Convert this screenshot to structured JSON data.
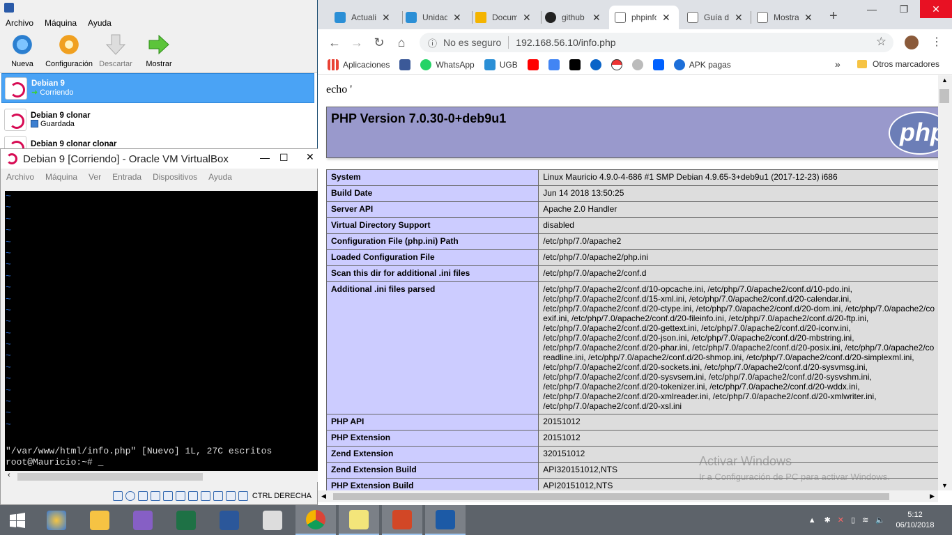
{
  "vbox_manager": {
    "menu": [
      "Archivo",
      "Máquina",
      "Ayuda"
    ],
    "toolbar": [
      "Nueva",
      "Configuración",
      "Descartar",
      "Mostrar"
    ],
    "vms": [
      {
        "name": "Debian 9",
        "state": "Corriendo"
      },
      {
        "name": "Debian 9 clonar",
        "state": "Guardada"
      },
      {
        "name": "Debian 9 clonar clonar",
        "state": ""
      }
    ]
  },
  "vm_window": {
    "title": "Debian 9 [Corriendo] - Oracle VM VirtualBox",
    "menu": [
      "Archivo",
      "Máquina",
      "Ver",
      "Entrada",
      "Dispositivos",
      "Ayuda"
    ],
    "terminal_line1": "\"/var/www/html/info.php\" [Nuevo] 1L, 27C escritos",
    "terminal_line2": "root@Mauricio:~# _",
    "host_key": "CTRL DERECHA"
  },
  "chrome": {
    "tabs": [
      "Actualiz",
      "Unidad",
      "Docum",
      "github",
      "phpinfo",
      "Guía d",
      "Mostra"
    ],
    "active_tab": 4,
    "security": "No es seguro",
    "url": "192.168.56.10/info.php",
    "bookmarks": [
      "Aplicaciones",
      "",
      "WhatsApp",
      "UGB",
      "",
      "",
      "",
      "",
      "",
      "",
      "",
      "APK pagas"
    ],
    "other_bookmarks": "Otros marcadores",
    "page": {
      "echo": "echo '",
      "version": "PHP Version 7.0.30-0+deb9u1",
      "logo": "php",
      "rows": [
        [
          "System",
          "Linux Mauricio 4.9.0-4-686 #1 SMP Debian 4.9.65-3+deb9u1 (2017-12-23) i686"
        ],
        [
          "Build Date",
          "Jun 14 2018 13:50:25"
        ],
        [
          "Server API",
          "Apache 2.0 Handler"
        ],
        [
          "Virtual Directory Support",
          "disabled"
        ],
        [
          "Configuration File (php.ini) Path",
          "/etc/php/7.0/apache2"
        ],
        [
          "Loaded Configuration File",
          "/etc/php/7.0/apache2/php.ini"
        ],
        [
          "Scan this dir for additional .ini files",
          "/etc/php/7.0/apache2/conf.d"
        ],
        [
          "Additional .ini files parsed",
          "/etc/php/7.0/apache2/conf.d/10-opcache.ini, /etc/php/7.0/apache2/conf.d/10-pdo.ini,\n/etc/php/7.0/apache2/conf.d/15-xml.ini, /etc/php/7.0/apache2/conf.d/20-calendar.ini,\n/etc/php/7.0/apache2/conf.d/20-ctype.ini, /etc/php/7.0/apache2/conf.d/20-dom.ini, /etc/php/7.0/apache2/co\nexif.ini, /etc/php/7.0/apache2/conf.d/20-fileinfo.ini, /etc/php/7.0/apache2/conf.d/20-ftp.ini,\n/etc/php/7.0/apache2/conf.d/20-gettext.ini, /etc/php/7.0/apache2/conf.d/20-iconv.ini,\n/etc/php/7.0/apache2/conf.d/20-json.ini, /etc/php/7.0/apache2/conf.d/20-mbstring.ini,\n/etc/php/7.0/apache2/conf.d/20-phar.ini, /etc/php/7.0/apache2/conf.d/20-posix.ini, /etc/php/7.0/apache2/co\nreadline.ini, /etc/php/7.0/apache2/conf.d/20-shmop.ini, /etc/php/7.0/apache2/conf.d/20-simplexml.ini,\n/etc/php/7.0/apache2/conf.d/20-sockets.ini, /etc/php/7.0/apache2/conf.d/20-sysvmsg.ini,\n/etc/php/7.0/apache2/conf.d/20-sysvsem.ini, /etc/php/7.0/apache2/conf.d/20-sysvshm.ini,\n/etc/php/7.0/apache2/conf.d/20-tokenizer.ini, /etc/php/7.0/apache2/conf.d/20-wddx.ini,\n/etc/php/7.0/apache2/conf.d/20-xmlreader.ini, /etc/php/7.0/apache2/conf.d/20-xmlwriter.ini,\n/etc/php/7.0/apache2/conf.d/20-xsl.ini"
        ],
        [
          "PHP API",
          "20151012"
        ],
        [
          "PHP Extension",
          "20151012"
        ],
        [
          "Zend Extension",
          "320151012"
        ],
        [
          "Zend Extension Build",
          "API320151012,NTS"
        ],
        [
          "PHP Extension Build",
          "API20151012,NTS"
        ]
      ]
    }
  },
  "watermark": {
    "title": "Activar Windows",
    "subtitle": "Ir a Configuración de PC para activar Windows."
  },
  "taskbar": {
    "time": "5:12",
    "date": "06/10/2018"
  }
}
